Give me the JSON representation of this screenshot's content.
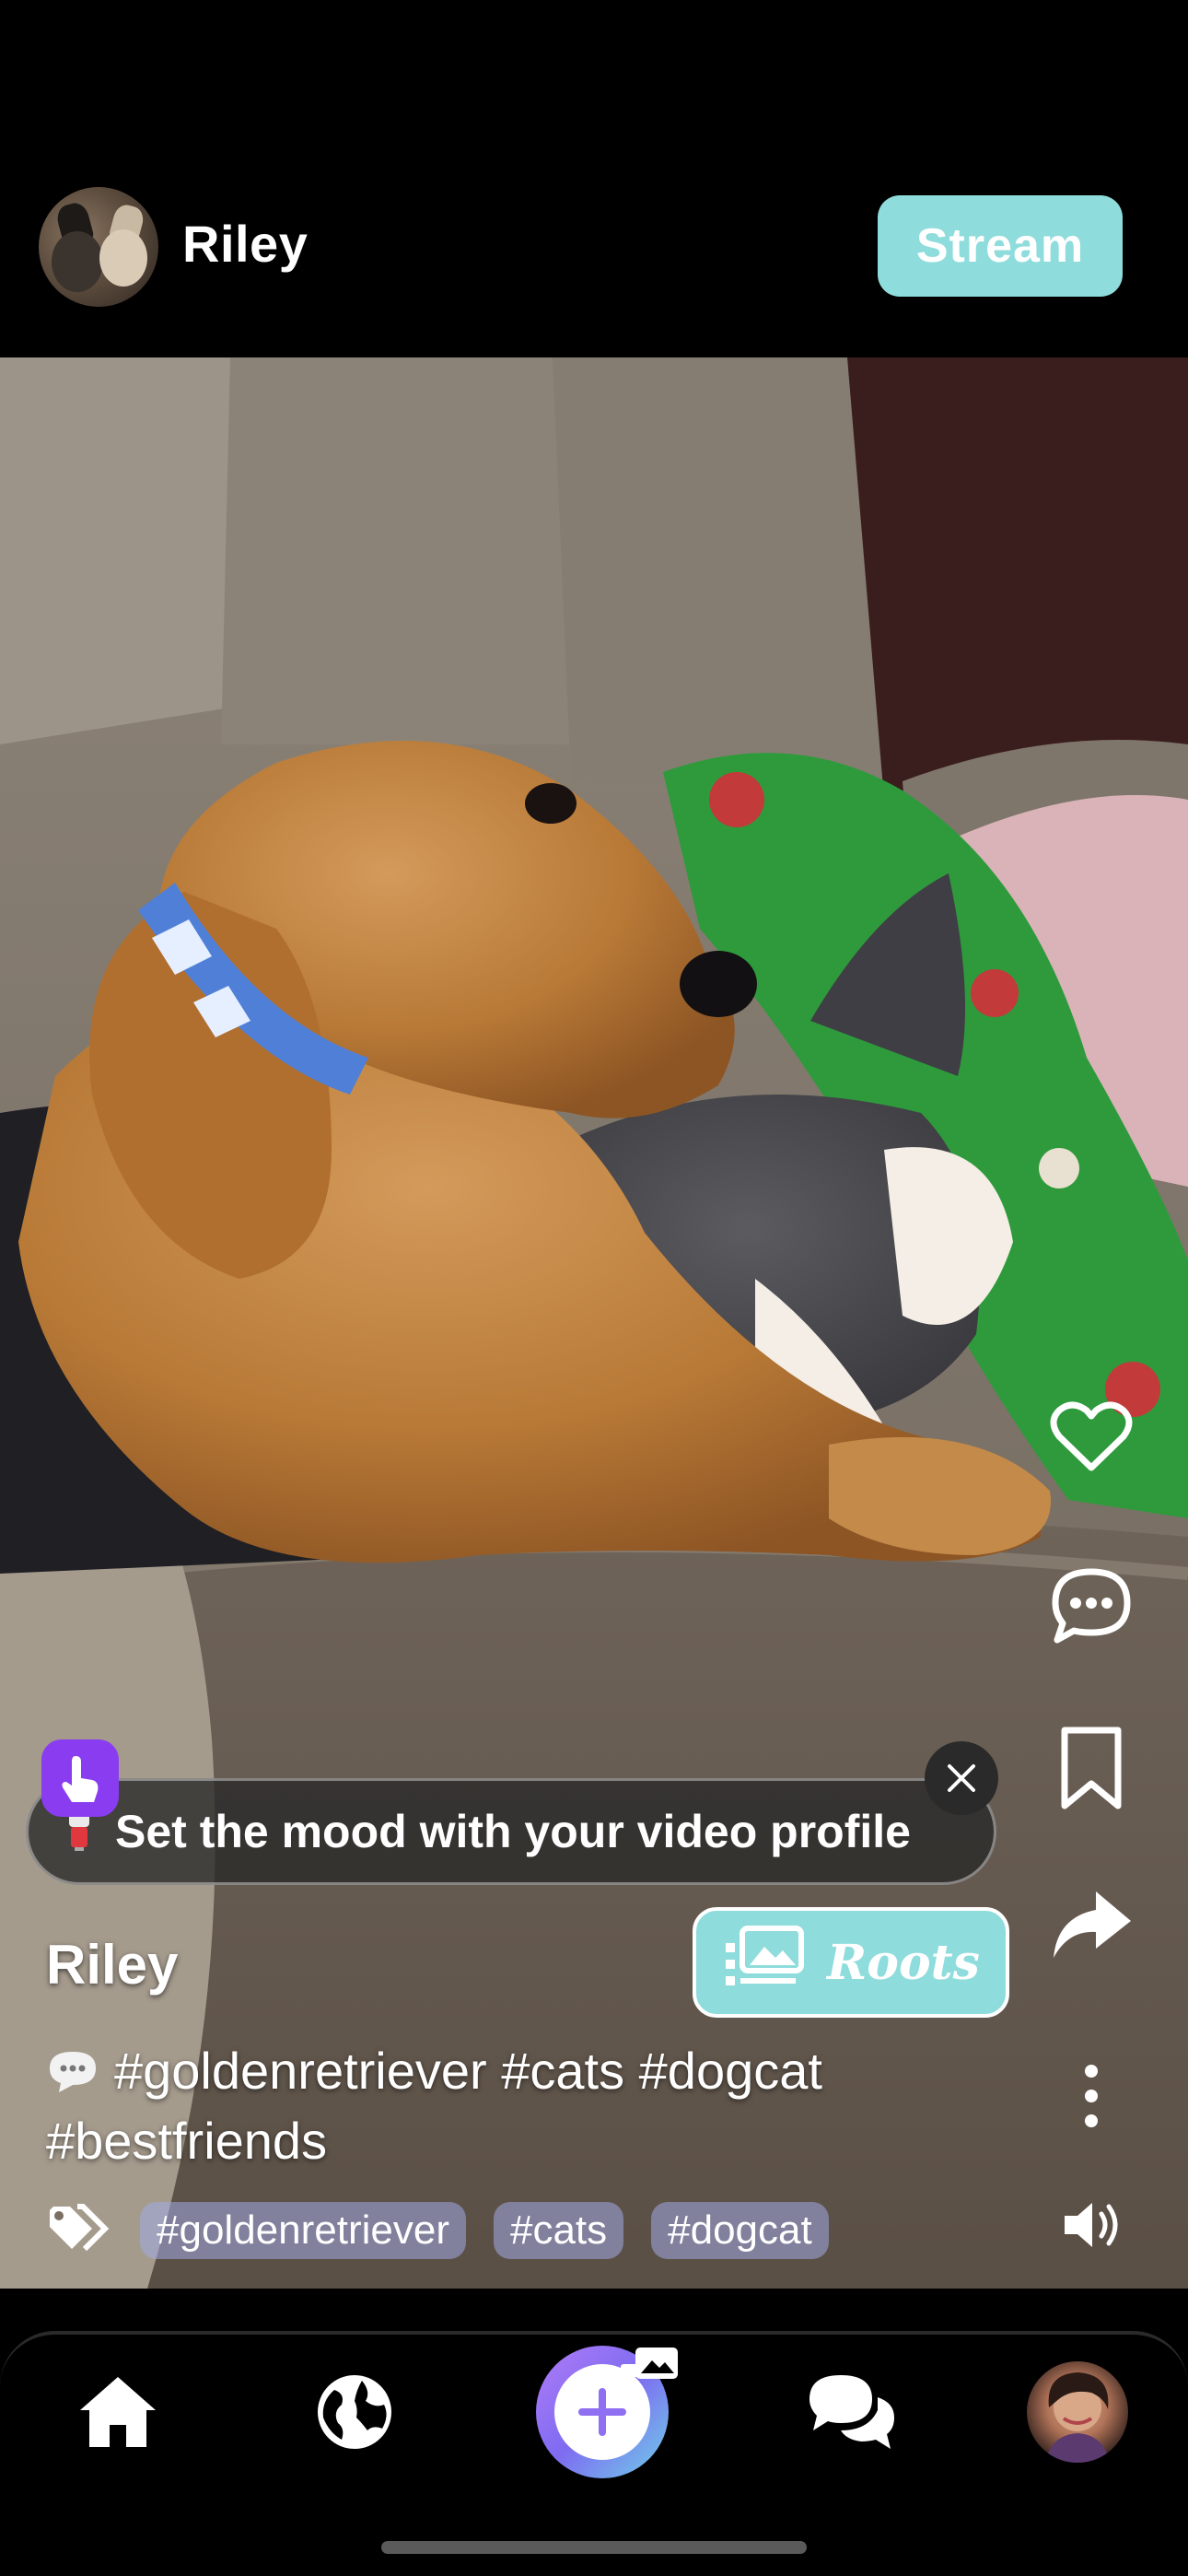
{
  "header": {
    "username": "Riley",
    "stream_label": "Stream"
  },
  "post": {
    "author": "Riley",
    "roots_label": "Roots",
    "caption": "#goldenretriever #cats #dogcat #bestfriends",
    "tags": [
      "#goldenretriever",
      "#cats",
      "#dogcat"
    ]
  },
  "tooltip": {
    "text": "Set the mood with your video profile"
  },
  "icons": {
    "like": "heart-icon",
    "comment": "comment-icon",
    "save": "bookmark-icon",
    "share": "share-icon",
    "more": "more-vertical-icon",
    "volume": "volume-icon",
    "tags": "tags-icon",
    "home": "home-icon",
    "explore": "globe-icon",
    "create": "plus-icon",
    "messages": "chat-icon"
  },
  "colors": {
    "accent_teal": "#8fdcdc",
    "badge_purple": "#8a3df0",
    "tag_chip": "#a0aae6"
  }
}
